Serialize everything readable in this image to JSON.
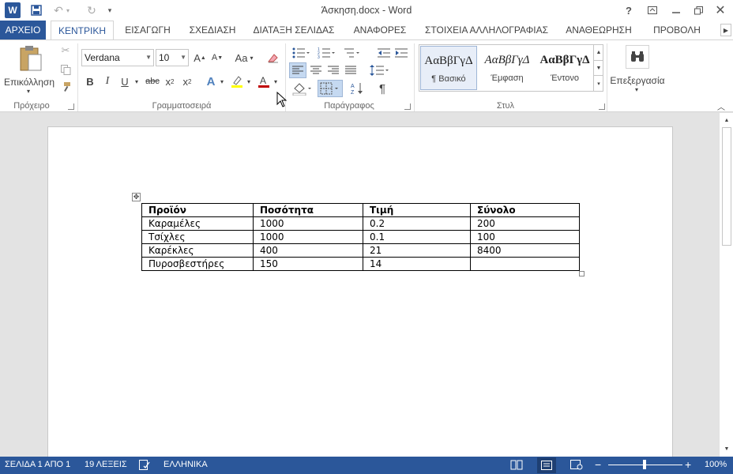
{
  "window": {
    "title": "Άσκηση.docx - Word"
  },
  "tabs": [
    "ΑΡΧΕΙΟ",
    "ΚΕΝΤΡΙΚΗ",
    "ΕΙΣΑΓΩΓΗ",
    "ΣΧΕΔΙΑΣΗ",
    "ΔΙΑΤΑΞΗ ΣΕΛΙΔΑΣ",
    "ΑΝΑΦΟΡΕΣ",
    "ΣΤΟΙΧΕΙΑ ΑΛΛΗΛΟΓΡΑΦΙΑΣ",
    "ΑΝΑΘΕΩΡΗΣΗ",
    "ΠΡΟΒΟΛΗ"
  ],
  "ribbon": {
    "clipboard": {
      "paste_label": "Επικόλληση",
      "group_label": "Πρόχειρο"
    },
    "font": {
      "name": "Verdana",
      "size": "10",
      "group_label": "Γραμματοσειρά",
      "change_case": "Aa"
    },
    "paragraph": {
      "group_label": "Παράγραφος"
    },
    "styles": {
      "group_label": "Στυλ",
      "items": [
        {
          "sample": "ΑαΒβΓγΔ",
          "name": "¶ Βασικό"
        },
        {
          "sample": "ΑαΒβΓγΔ",
          "name": "Έμφαση"
        },
        {
          "sample": "ΑαΒβΓγΔ",
          "name": "Έντονο"
        }
      ]
    },
    "editing": {
      "label": "Επεξεργασία"
    }
  },
  "document": {
    "table": {
      "headers": [
        "Προϊόν",
        "Ποσότητα",
        "Τιμή",
        "Σύνολο"
      ],
      "rows": [
        [
          "Καραμέλες",
          "1000",
          "0.2",
          "200"
        ],
        [
          "Τσίχλες",
          "1000",
          "0.1",
          "100"
        ],
        [
          "Καρέκλες",
          "400",
          "21",
          "8400"
        ],
        [
          "Πυροσβεστήρες",
          "150",
          "14",
          ""
        ]
      ]
    }
  },
  "status": {
    "page": "ΣΕΛΙΔΑ 1 ΑΠΟ 1",
    "words": "19 ΛΕΞΕΙΣ",
    "language": "ΕΛΛΗΝΙΚΑ",
    "zoom": "100%"
  },
  "colors": {
    "accent": "#2b579a",
    "highlight": "#ffff00",
    "font_color": "#c00000"
  }
}
